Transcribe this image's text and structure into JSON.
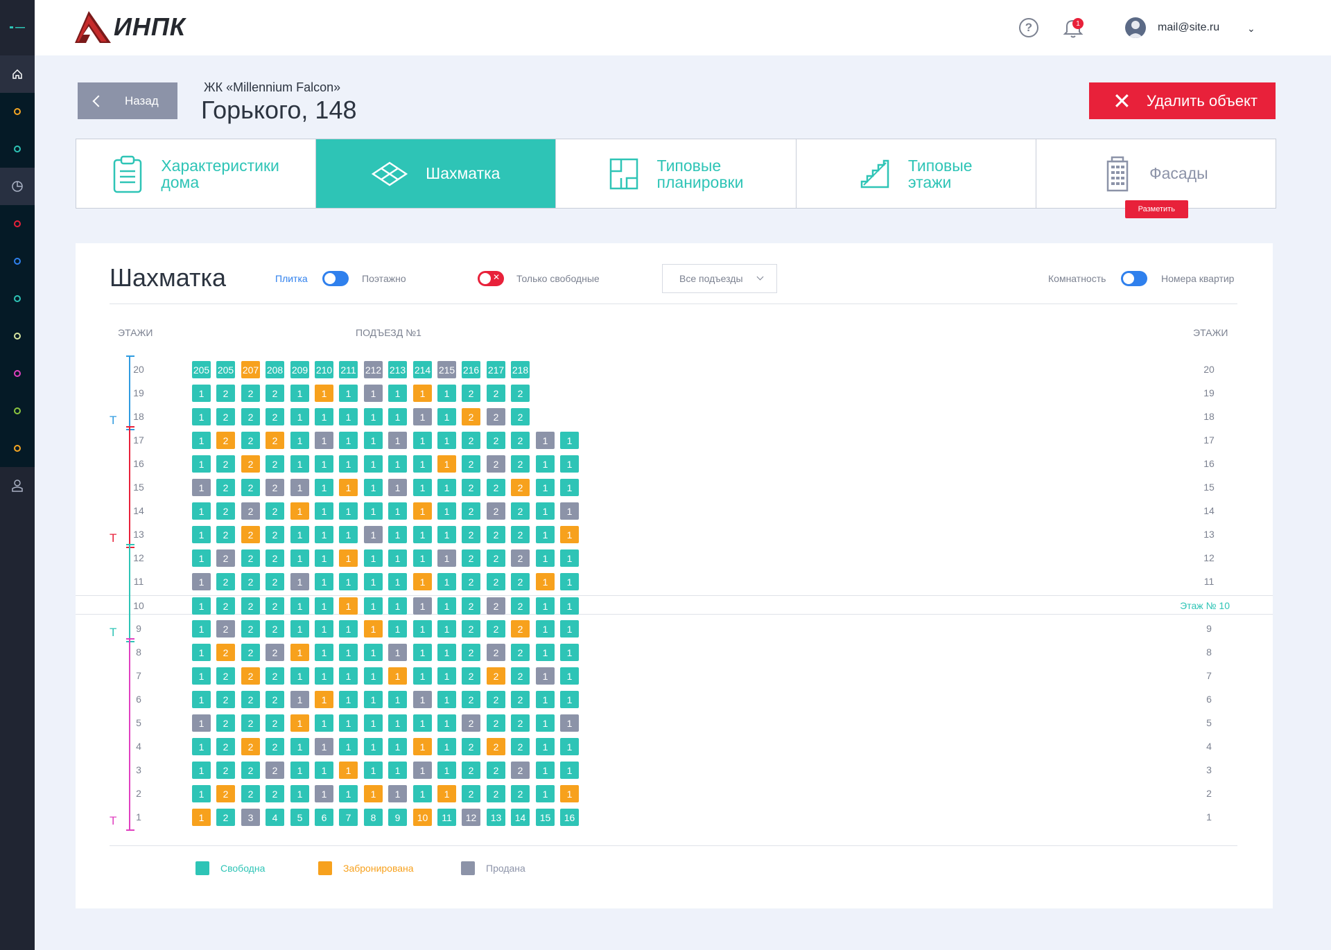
{
  "header": {
    "logo_text": "ИНПК",
    "help_icon": "?",
    "notification_count": "1",
    "user_email": "mail@site.ru"
  },
  "page": {
    "back_label": "Назад",
    "complex_name": "ЖК «Millennium Falcon»",
    "address": "Горького, 148",
    "delete_label": "Удалить объект"
  },
  "tabs": [
    {
      "label": "Характеристики\nдома",
      "icon": "clipboard-icon"
    },
    {
      "label": "Шахматка",
      "icon": "layers-icon"
    },
    {
      "label": "Типовые\nпланировки",
      "icon": "floorplan-icon"
    },
    {
      "label": "Типовые\nэтажи",
      "icon": "stairs-icon"
    },
    {
      "label": "Фасады",
      "icon": "building-icon",
      "badge": "Разметить"
    }
  ],
  "panel": {
    "title": "Шахматка",
    "toggle_left": "Плитка",
    "toggle_right": "Поэтажно",
    "only_free": "Только свободные",
    "entrances_select": "Все подъезды",
    "rooms_label": "Комнатность",
    "apartments_label": "Номера квартир",
    "floors_header_left": "ЭТАЖИ",
    "entrance_header": "ПОДЪЕЗД №1",
    "floors_header_right": "ЭТАЖИ",
    "highlight_label": "Этаж №  10"
  },
  "colors": {
    "free": "#2ec4b6",
    "booked": "#f7a11d",
    "sold": "#8c93a8",
    "danger": "#e8213a"
  },
  "legend": [
    {
      "label": "Свободна",
      "status": "free",
      "color": "#2ec4b6"
    },
    {
      "label": "Забронирована",
      "status": "booked",
      "color": "#f7a11d"
    },
    {
      "label": "Продана",
      "status": "sold",
      "color": "#8c93a8"
    }
  ],
  "floor_groups": [
    {
      "mark": "Т",
      "color": "#2f9be0",
      "from": 20,
      "to": 18
    },
    {
      "mark": "Т",
      "color": "#e8213a",
      "from": 17,
      "to": 13
    },
    {
      "mark": "Т",
      "color": "#2ec4b6",
      "from": 12,
      "to": 9
    },
    {
      "mark": "Т",
      "color": "#e040c0",
      "from": 8,
      "to": 1
    }
  ],
  "floors": [
    {
      "floor": "20",
      "cells": [
        [
          "205",
          "f"
        ],
        [
          "205",
          "f"
        ],
        [
          "207",
          "b"
        ],
        [
          "208",
          "f"
        ],
        [
          "209",
          "f"
        ],
        [
          "210",
          "f"
        ],
        [
          "211",
          "f"
        ],
        [
          "212",
          "s"
        ],
        [
          "213",
          "f"
        ],
        [
          "214",
          "f"
        ],
        [
          "215",
          "s"
        ],
        [
          "216",
          "f"
        ],
        [
          "217",
          "f"
        ],
        [
          "218",
          "f"
        ]
      ]
    },
    {
      "floor": "19",
      "cells": [
        [
          "1",
          "f"
        ],
        [
          "2",
          "f"
        ],
        [
          "2",
          "f"
        ],
        [
          "2",
          "f"
        ],
        [
          "1",
          "f"
        ],
        [
          "1",
          "b"
        ],
        [
          "1",
          "f"
        ],
        [
          "1",
          "s"
        ],
        [
          "1",
          "f"
        ],
        [
          "1",
          "b"
        ],
        [
          "1",
          "f"
        ],
        [
          "2",
          "f"
        ],
        [
          "2",
          "f"
        ],
        [
          "2",
          "f"
        ]
      ]
    },
    {
      "floor": "18",
      "cells": [
        [
          "1",
          "f"
        ],
        [
          "2",
          "f"
        ],
        [
          "2",
          "f"
        ],
        [
          "2",
          "f"
        ],
        [
          "1",
          "f"
        ],
        [
          "1",
          "f"
        ],
        [
          "1",
          "f"
        ],
        [
          "1",
          "f"
        ],
        [
          "1",
          "f"
        ],
        [
          "1",
          "s"
        ],
        [
          "1",
          "f"
        ],
        [
          "2",
          "b"
        ],
        [
          "2",
          "s"
        ],
        [
          "2",
          "f"
        ]
      ]
    },
    {
      "floor": "17",
      "cells": [
        [
          "1",
          "f"
        ],
        [
          "2",
          "b"
        ],
        [
          "2",
          "f"
        ],
        [
          "2",
          "b"
        ],
        [
          "1",
          "f"
        ],
        [
          "1",
          "s"
        ],
        [
          "1",
          "f"
        ],
        [
          "1",
          "f"
        ],
        [
          "1",
          "s"
        ],
        [
          "1",
          "f"
        ],
        [
          "1",
          "f"
        ],
        [
          "2",
          "f"
        ],
        [
          "2",
          "f"
        ],
        [
          "2",
          "f"
        ],
        [
          "1",
          "s"
        ],
        [
          "1",
          "f"
        ]
      ]
    },
    {
      "floor": "16",
      "cells": [
        [
          "1",
          "f"
        ],
        [
          "2",
          "f"
        ],
        [
          "2",
          "b"
        ],
        [
          "2",
          "f"
        ],
        [
          "1",
          "f"
        ],
        [
          "1",
          "f"
        ],
        [
          "1",
          "f"
        ],
        [
          "1",
          "f"
        ],
        [
          "1",
          "f"
        ],
        [
          "1",
          "f"
        ],
        [
          "1",
          "b"
        ],
        [
          "2",
          "f"
        ],
        [
          "2",
          "s"
        ],
        [
          "2",
          "f"
        ],
        [
          "1",
          "f"
        ],
        [
          "1",
          "f"
        ]
      ]
    },
    {
      "floor": "15",
      "cells": [
        [
          "1",
          "s"
        ],
        [
          "2",
          "f"
        ],
        [
          "2",
          "f"
        ],
        [
          "2",
          "s"
        ],
        [
          "1",
          "s"
        ],
        [
          "1",
          "f"
        ],
        [
          "1",
          "b"
        ],
        [
          "1",
          "f"
        ],
        [
          "1",
          "s"
        ],
        [
          "1",
          "f"
        ],
        [
          "1",
          "f"
        ],
        [
          "2",
          "f"
        ],
        [
          "2",
          "f"
        ],
        [
          "2",
          "b"
        ],
        [
          "1",
          "f"
        ],
        [
          "1",
          "f"
        ]
      ]
    },
    {
      "floor": "14",
      "cells": [
        [
          "1",
          "f"
        ],
        [
          "2",
          "f"
        ],
        [
          "2",
          "s"
        ],
        [
          "2",
          "f"
        ],
        [
          "1",
          "b"
        ],
        [
          "1",
          "f"
        ],
        [
          "1",
          "f"
        ],
        [
          "1",
          "f"
        ],
        [
          "1",
          "f"
        ],
        [
          "1",
          "b"
        ],
        [
          "1",
          "f"
        ],
        [
          "2",
          "f"
        ],
        [
          "2",
          "s"
        ],
        [
          "2",
          "f"
        ],
        [
          "1",
          "f"
        ],
        [
          "1",
          "s"
        ]
      ]
    },
    {
      "floor": "13",
      "cells": [
        [
          "1",
          "f"
        ],
        [
          "2",
          "f"
        ],
        [
          "2",
          "b"
        ],
        [
          "2",
          "f"
        ],
        [
          "1",
          "f"
        ],
        [
          "1",
          "f"
        ],
        [
          "1",
          "f"
        ],
        [
          "1",
          "s"
        ],
        [
          "1",
          "f"
        ],
        [
          "1",
          "f"
        ],
        [
          "1",
          "f"
        ],
        [
          "2",
          "f"
        ],
        [
          "2",
          "f"
        ],
        [
          "2",
          "f"
        ],
        [
          "1",
          "f"
        ],
        [
          "1",
          "b"
        ]
      ]
    },
    {
      "floor": "12",
      "cells": [
        [
          "1",
          "f"
        ],
        [
          "2",
          "s"
        ],
        [
          "2",
          "f"
        ],
        [
          "2",
          "f"
        ],
        [
          "1",
          "f"
        ],
        [
          "1",
          "f"
        ],
        [
          "1",
          "b"
        ],
        [
          "1",
          "f"
        ],
        [
          "1",
          "f"
        ],
        [
          "1",
          "f"
        ],
        [
          "1",
          "s"
        ],
        [
          "2",
          "f"
        ],
        [
          "2",
          "f"
        ],
        [
          "2",
          "s"
        ],
        [
          "1",
          "f"
        ],
        [
          "1",
          "f"
        ]
      ]
    },
    {
      "floor": "11",
      "cells": [
        [
          "1",
          "s"
        ],
        [
          "2",
          "f"
        ],
        [
          "2",
          "f"
        ],
        [
          "2",
          "f"
        ],
        [
          "1",
          "s"
        ],
        [
          "1",
          "f"
        ],
        [
          "1",
          "f"
        ],
        [
          "1",
          "f"
        ],
        [
          "1",
          "f"
        ],
        [
          "1",
          "b"
        ],
        [
          "1",
          "f"
        ],
        [
          "2",
          "f"
        ],
        [
          "2",
          "f"
        ],
        [
          "2",
          "f"
        ],
        [
          "1",
          "b"
        ],
        [
          "1",
          "f"
        ]
      ]
    },
    {
      "floor": "10",
      "cells": [
        [
          "1",
          "f"
        ],
        [
          "2",
          "f"
        ],
        [
          "2",
          "f"
        ],
        [
          "2",
          "f"
        ],
        [
          "1",
          "f"
        ],
        [
          "1",
          "f"
        ],
        [
          "1",
          "b"
        ],
        [
          "1",
          "f"
        ],
        [
          "1",
          "f"
        ],
        [
          "1",
          "s"
        ],
        [
          "1",
          "f"
        ],
        [
          "2",
          "f"
        ],
        [
          "2",
          "s"
        ],
        [
          "2",
          "f"
        ],
        [
          "1",
          "f"
        ],
        [
          "1",
          "f"
        ]
      ]
    },
    {
      "floor": "9",
      "cells": [
        [
          "1",
          "f"
        ],
        [
          "2",
          "s"
        ],
        [
          "2",
          "f"
        ],
        [
          "2",
          "f"
        ],
        [
          "1",
          "f"
        ],
        [
          "1",
          "f"
        ],
        [
          "1",
          "f"
        ],
        [
          "1",
          "b"
        ],
        [
          "1",
          "f"
        ],
        [
          "1",
          "f"
        ],
        [
          "1",
          "f"
        ],
        [
          "2",
          "f"
        ],
        [
          "2",
          "f"
        ],
        [
          "2",
          "b"
        ],
        [
          "1",
          "f"
        ],
        [
          "1",
          "f"
        ]
      ]
    },
    {
      "floor": "8",
      "cells": [
        [
          "1",
          "f"
        ],
        [
          "2",
          "b"
        ],
        [
          "2",
          "f"
        ],
        [
          "2",
          "s"
        ],
        [
          "1",
          "b"
        ],
        [
          "1",
          "f"
        ],
        [
          "1",
          "f"
        ],
        [
          "1",
          "f"
        ],
        [
          "1",
          "s"
        ],
        [
          "1",
          "f"
        ],
        [
          "1",
          "f"
        ],
        [
          "2",
          "f"
        ],
        [
          "2",
          "s"
        ],
        [
          "2",
          "f"
        ],
        [
          "1",
          "f"
        ],
        [
          "1",
          "f"
        ]
      ]
    },
    {
      "floor": "7",
      "cells": [
        [
          "1",
          "f"
        ],
        [
          "2",
          "f"
        ],
        [
          "2",
          "b"
        ],
        [
          "2",
          "f"
        ],
        [
          "1",
          "f"
        ],
        [
          "1",
          "f"
        ],
        [
          "1",
          "f"
        ],
        [
          "1",
          "f"
        ],
        [
          "1",
          "b"
        ],
        [
          "1",
          "f"
        ],
        [
          "1",
          "f"
        ],
        [
          "2",
          "f"
        ],
        [
          "2",
          "b"
        ],
        [
          "2",
          "f"
        ],
        [
          "1",
          "s"
        ],
        [
          "1",
          "f"
        ]
      ]
    },
    {
      "floor": "6",
      "cells": [
        [
          "1",
          "f"
        ],
        [
          "2",
          "f"
        ],
        [
          "2",
          "f"
        ],
        [
          "2",
          "f"
        ],
        [
          "1",
          "s"
        ],
        [
          "1",
          "b"
        ],
        [
          "1",
          "f"
        ],
        [
          "1",
          "f"
        ],
        [
          "1",
          "f"
        ],
        [
          "1",
          "s"
        ],
        [
          "1",
          "f"
        ],
        [
          "2",
          "f"
        ],
        [
          "2",
          "f"
        ],
        [
          "2",
          "f"
        ],
        [
          "1",
          "f"
        ],
        [
          "1",
          "f"
        ]
      ]
    },
    {
      "floor": "5",
      "cells": [
        [
          "1",
          "s"
        ],
        [
          "2",
          "f"
        ],
        [
          "2",
          "f"
        ],
        [
          "2",
          "f"
        ],
        [
          "1",
          "b"
        ],
        [
          "1",
          "f"
        ],
        [
          "1",
          "f"
        ],
        [
          "1",
          "f"
        ],
        [
          "1",
          "f"
        ],
        [
          "1",
          "f"
        ],
        [
          "1",
          "f"
        ],
        [
          "2",
          "s"
        ],
        [
          "2",
          "f"
        ],
        [
          "2",
          "f"
        ],
        [
          "1",
          "f"
        ],
        [
          "1",
          "s"
        ]
      ]
    },
    {
      "floor": "4",
      "cells": [
        [
          "1",
          "f"
        ],
        [
          "2",
          "f"
        ],
        [
          "2",
          "b"
        ],
        [
          "2",
          "f"
        ],
        [
          "1",
          "f"
        ],
        [
          "1",
          "s"
        ],
        [
          "1",
          "f"
        ],
        [
          "1",
          "f"
        ],
        [
          "1",
          "f"
        ],
        [
          "1",
          "b"
        ],
        [
          "1",
          "f"
        ],
        [
          "2",
          "f"
        ],
        [
          "2",
          "b"
        ],
        [
          "2",
          "f"
        ],
        [
          "1",
          "f"
        ],
        [
          "1",
          "f"
        ]
      ]
    },
    {
      "floor": "3",
      "cells": [
        [
          "1",
          "f"
        ],
        [
          "2",
          "f"
        ],
        [
          "2",
          "f"
        ],
        [
          "2",
          "s"
        ],
        [
          "1",
          "f"
        ],
        [
          "1",
          "f"
        ],
        [
          "1",
          "b"
        ],
        [
          "1",
          "f"
        ],
        [
          "1",
          "f"
        ],
        [
          "1",
          "s"
        ],
        [
          "1",
          "f"
        ],
        [
          "2",
          "f"
        ],
        [
          "2",
          "f"
        ],
        [
          "2",
          "s"
        ],
        [
          "1",
          "f"
        ],
        [
          "1",
          "f"
        ]
      ]
    },
    {
      "floor": "2",
      "cells": [
        [
          "1",
          "f"
        ],
        [
          "2",
          "b"
        ],
        [
          "2",
          "f"
        ],
        [
          "2",
          "f"
        ],
        [
          "1",
          "f"
        ],
        [
          "1",
          "s"
        ],
        [
          "1",
          "f"
        ],
        [
          "1",
          "b"
        ],
        [
          "1",
          "s"
        ],
        [
          "1",
          "f"
        ],
        [
          "1",
          "b"
        ],
        [
          "2",
          "f"
        ],
        [
          "2",
          "f"
        ],
        [
          "2",
          "f"
        ],
        [
          "1",
          "f"
        ],
        [
          "1",
          "b"
        ]
      ]
    },
    {
      "floor": "1",
      "cells": [
        [
          "1",
          "b"
        ],
        [
          "2",
          "f"
        ],
        [
          "3",
          "s"
        ],
        [
          "4",
          "f"
        ],
        [
          "5",
          "f"
        ],
        [
          "6",
          "f"
        ],
        [
          "7",
          "f"
        ],
        [
          "8",
          "f"
        ],
        [
          "9",
          "f"
        ],
        [
          "10",
          "b"
        ],
        [
          "11",
          "f"
        ],
        [
          "12",
          "s"
        ],
        [
          "13",
          "f"
        ],
        [
          "14",
          "f"
        ],
        [
          "15",
          "f"
        ],
        [
          "16",
          "f"
        ]
      ]
    }
  ]
}
